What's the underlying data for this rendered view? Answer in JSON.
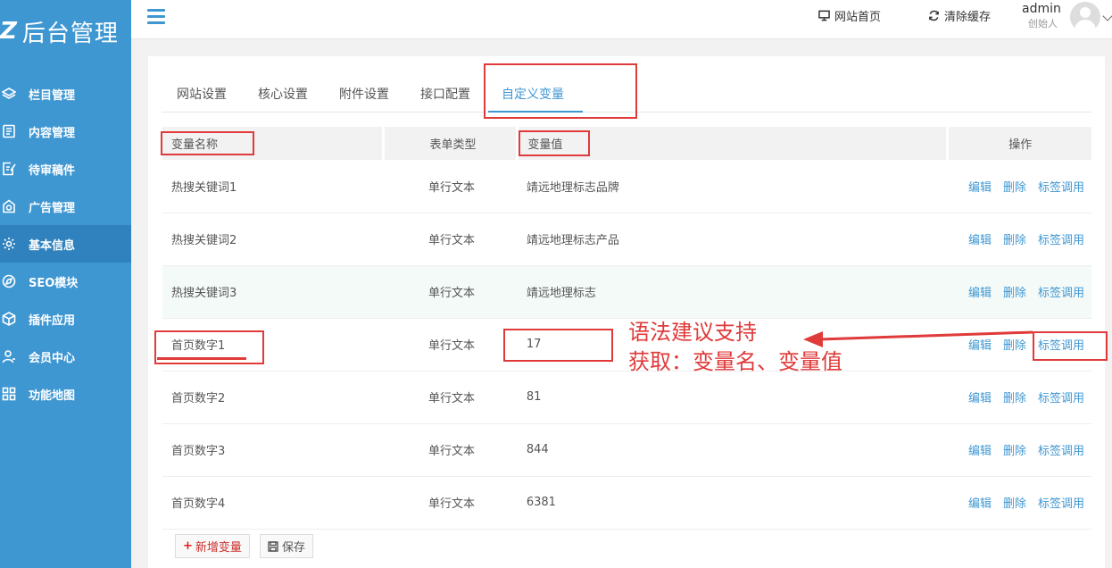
{
  "brand": {
    "mark": "Z",
    "title": "后台管理"
  },
  "sidebar": {
    "items": [
      {
        "label": "栏目管理",
        "icon": "layers-icon"
      },
      {
        "label": "内容管理",
        "icon": "document-icon"
      },
      {
        "label": "待审稿件",
        "icon": "edit-doc-icon"
      },
      {
        "label": "广告管理",
        "icon": "ad-icon"
      },
      {
        "label": "基本信息",
        "icon": "gear-icon"
      },
      {
        "label": "SEO模块",
        "icon": "compass-icon"
      },
      {
        "label": "插件应用",
        "icon": "cube-icon"
      },
      {
        "label": "会员中心",
        "icon": "user-icon"
      },
      {
        "label": "功能地图",
        "icon": "grid-icon"
      }
    ],
    "active_index": 4
  },
  "header": {
    "site_home": "网站首页",
    "clear_cache": "清除缓存",
    "user_name": "admin",
    "user_role": "创始人"
  },
  "tabs": [
    "网站设置",
    "核心设置",
    "附件设置",
    "接口配置",
    "自定义变量"
  ],
  "active_tab": 4,
  "table": {
    "headers": [
      "变量名称",
      "表单类型",
      "变量值",
      "操作"
    ],
    "rows": [
      {
        "name": "热搜关键词1",
        "type": "单行文本",
        "value": "靖远地理标志品牌"
      },
      {
        "name": "热搜关键词2",
        "type": "单行文本",
        "value": "靖远地理标志产品"
      },
      {
        "name": "热搜关键词3",
        "type": "单行文本",
        "value": "靖远地理标志"
      },
      {
        "name": "首页数字1",
        "type": "单行文本",
        "value": "17"
      },
      {
        "name": "首页数字2",
        "type": "单行文本",
        "value": "81"
      },
      {
        "name": "首页数字3",
        "type": "单行文本",
        "value": "844"
      },
      {
        "name": "首页数字4",
        "type": "单行文本",
        "value": "6381"
      }
    ],
    "actions": [
      "编辑",
      "删除",
      "标签调用"
    ]
  },
  "buttons": {
    "add": "新增变量",
    "save": "保存"
  },
  "annotation": {
    "line1": "语法建议支持",
    "line2": "获取：变量名、变量值",
    "color": "#e03a3a"
  },
  "colors": {
    "sidebar": "#3f97d2",
    "accent": "#3f97d2",
    "highlight_row": "#f3faf8"
  }
}
